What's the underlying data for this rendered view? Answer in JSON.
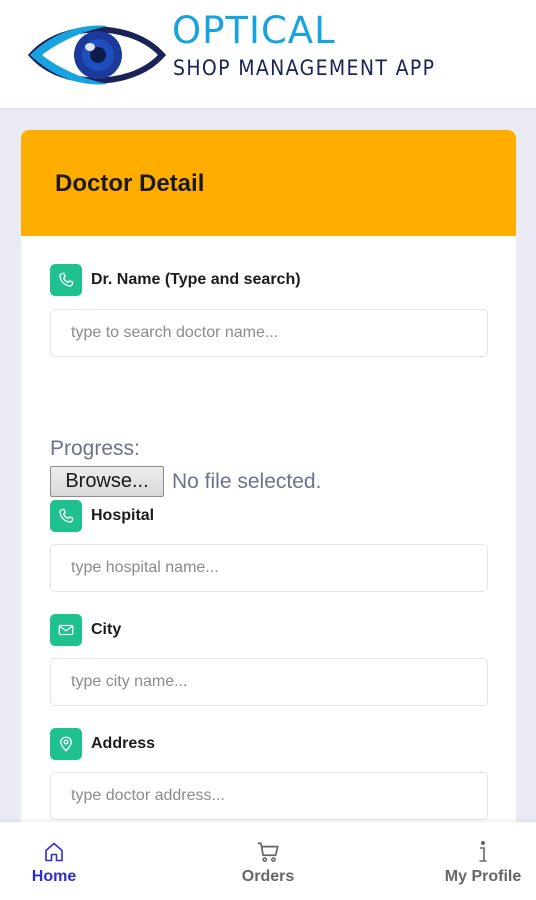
{
  "header": {
    "logo_title": "OPTICAL",
    "logo_subtitle": "SHOP MANAGEMENT APP"
  },
  "card": {
    "title": "Doctor Detail",
    "fields": [
      {
        "label": "Dr. Name (Type and search)",
        "icon": "phone-icon",
        "placeholder": "type to search doctor name..."
      },
      {
        "label": "Hospital",
        "icon": "phone-icon",
        "placeholder": "type hospital name..."
      },
      {
        "label": "City",
        "icon": "envelope-icon",
        "placeholder": "type city name..."
      },
      {
        "label": "Address",
        "icon": "location-pin-icon",
        "placeholder": "type doctor address..."
      }
    ],
    "upload": {
      "progress_label": "Progress:",
      "browse_label": "Browse...",
      "file_status": "No file selected."
    }
  },
  "bottom_nav": {
    "items": [
      {
        "label": "Home",
        "icon": "home-icon",
        "active": true
      },
      {
        "label": "Orders",
        "icon": "cart-icon",
        "active": false
      },
      {
        "label": "My Profile",
        "icon": "info-icon",
        "active": false
      }
    ]
  },
  "colors": {
    "accent_orange": "#ffae00",
    "icon_green": "#1ec18f",
    "nav_active": "#2f2fc8",
    "logo_blue": "#17a3e0",
    "logo_navy": "#1b2257"
  }
}
